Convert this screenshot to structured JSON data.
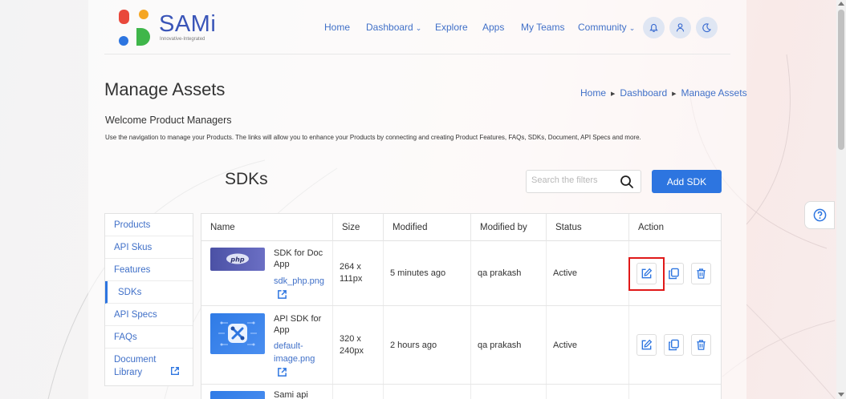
{
  "header": {
    "logo_text": "SAMi",
    "logo_tagline": "Innovative-Integrated",
    "nav": {
      "home": "Home",
      "dashboard": "Dashboard",
      "explore": "Explore",
      "apps": "Apps",
      "my_teams": "My Teams",
      "community": "Community"
    }
  },
  "page": {
    "title": "Manage Assets",
    "breadcrumb": [
      "Home",
      "Dashboard",
      "Manage Assets"
    ],
    "welcome": "Welcome Product Managers",
    "description": "Use the navigation to manage your Products. The links will allow you to enhance your Products by connecting and creating Product Features, FAQs, SDKs, Document, API Specs and more."
  },
  "section": {
    "title": "SDKs",
    "search_placeholder": "Search the filters",
    "add_button": "Add SDK"
  },
  "sidebar": {
    "items": [
      {
        "label": "Products"
      },
      {
        "label": "API Skus"
      },
      {
        "label": "Features"
      },
      {
        "label": "SDKs"
      },
      {
        "label": "API Specs"
      },
      {
        "label": "FAQs"
      },
      {
        "label": "Document Library"
      }
    ],
    "active": "SDKs"
  },
  "table": {
    "headers": [
      "Name",
      "Size",
      "Modified",
      "Modified by",
      "Status",
      "Action"
    ],
    "rows": [
      {
        "title": "SDK for Doc App",
        "file": "sdk_php.png",
        "thumb_label": "php",
        "size": "264 x 111px",
        "modified": "5 minutes ago",
        "modified_by": "qa prakash",
        "status": "Active"
      },
      {
        "title": "API SDK for App",
        "file": "default-image.png",
        "size": "320 x 240px",
        "modified": "2 hours ago",
        "modified_by": "qa prakash",
        "status": "Active"
      },
      {
        "title": "Sami api"
      }
    ]
  },
  "colors": {
    "accent": "#2d75e0",
    "link": "#4070c8",
    "highlight": "#e01919"
  }
}
